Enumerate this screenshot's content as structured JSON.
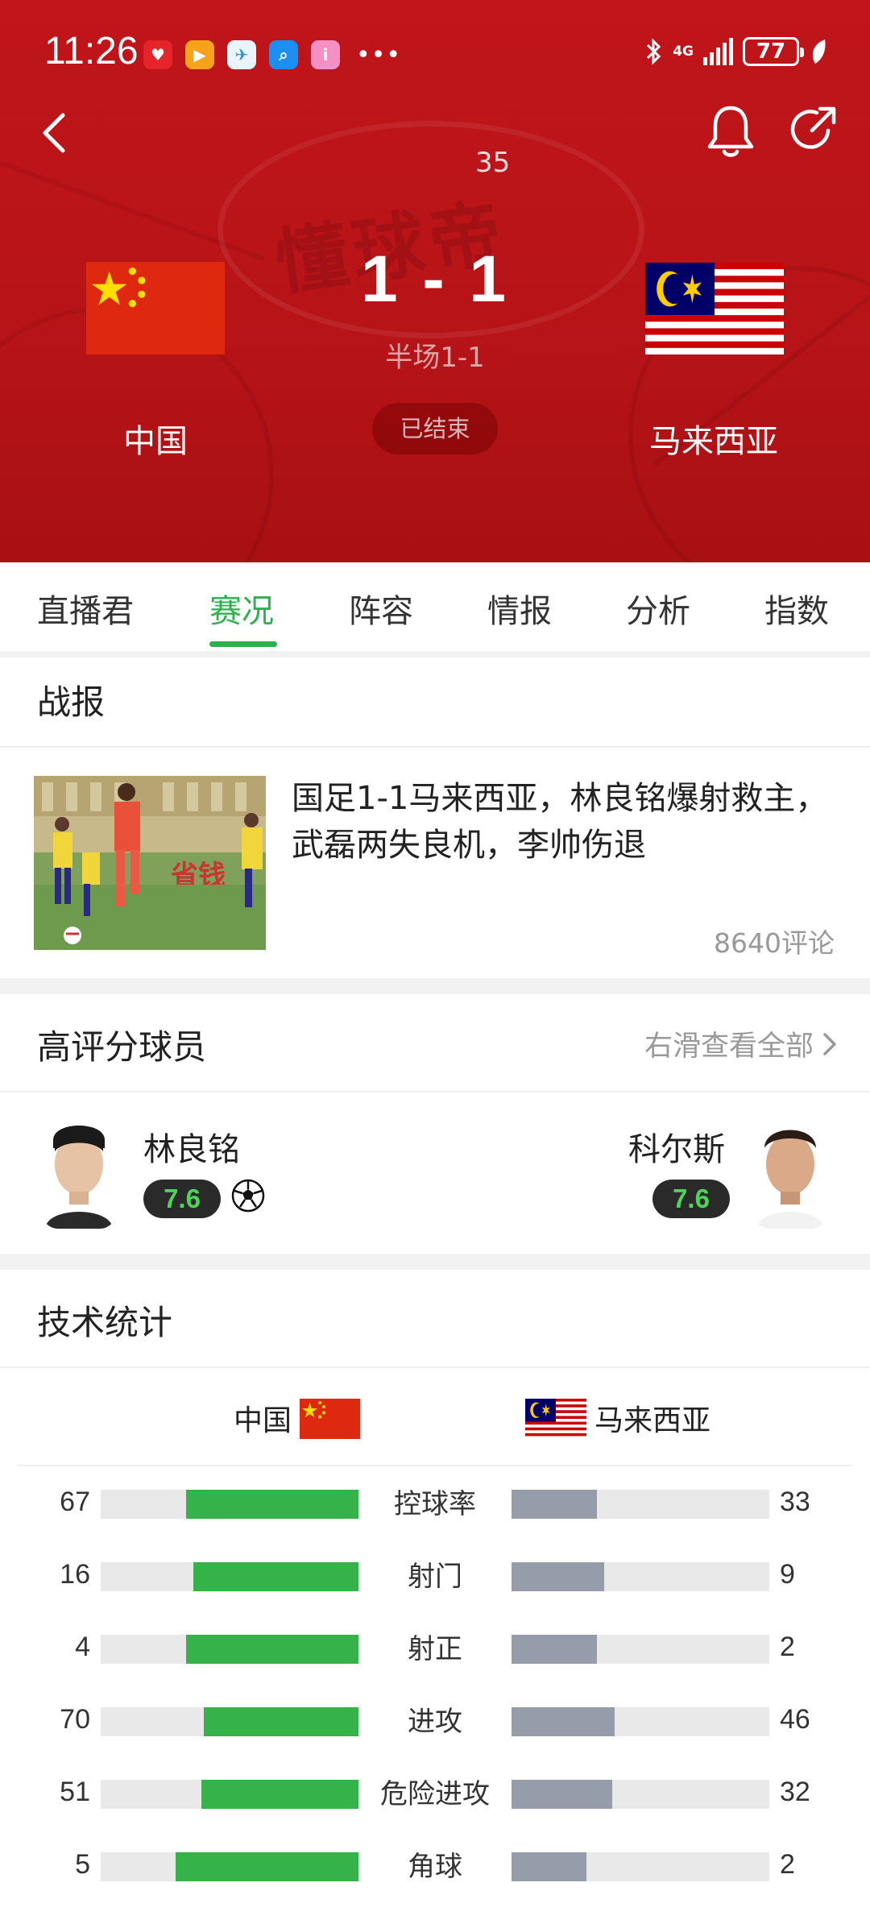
{
  "status_bar": {
    "time": "11:26",
    "battery": "77",
    "network": "4G"
  },
  "match": {
    "number_fragment": "35",
    "home_team": "中国",
    "away_team": "马来西亚",
    "score": "1 - 1",
    "half_time": "半场1-1",
    "status": "已结束"
  },
  "tabs": [
    "直播君",
    "赛况",
    "阵容",
    "情报",
    "分析",
    "指数"
  ],
  "active_tab": "赛况",
  "report": {
    "section_title": "战报",
    "headline": "国足1-1马来西亚，林良铭爆射救主，武磊两失良机，李帅伤退",
    "comments": "8640评论"
  },
  "top_players": {
    "section_title": "高评分球员",
    "view_all": "右滑查看全部",
    "home": {
      "name": "林良铭",
      "rating": "7.6"
    },
    "away": {
      "name": "科尔斯",
      "rating": "7.6"
    }
  },
  "tech_stats": {
    "section_title": "技术统计",
    "home_label": "中国",
    "away_label": "马来西亚",
    "rows": [
      {
        "label": "控球率",
        "home": "67",
        "away": "33",
        "home_pct": 0.67,
        "away_pct": 0.33
      },
      {
        "label": "射门",
        "home": "16",
        "away": "9",
        "home_pct": 0.64,
        "away_pct": 0.36
      },
      {
        "label": "射正",
        "home": "4",
        "away": "2",
        "home_pct": 0.67,
        "away_pct": 0.33
      },
      {
        "label": "进攻",
        "home": "70",
        "away": "46",
        "home_pct": 0.6,
        "away_pct": 0.4
      },
      {
        "label": "危险进攻",
        "home": "51",
        "away": "32",
        "home_pct": 0.61,
        "away_pct": 0.39
      },
      {
        "label": "角球",
        "home": "5",
        "away": "2",
        "home_pct": 0.71,
        "away_pct": 0.29
      }
    ]
  },
  "colors": {
    "header_red": "#c0151a",
    "accent_green": "#2db14d",
    "home_bar": "#35b349",
    "away_bar": "#959dab"
  },
  "icons": [
    "back-icon",
    "bell-icon",
    "share-icon",
    "chevron-right-icon",
    "football-icon"
  ]
}
